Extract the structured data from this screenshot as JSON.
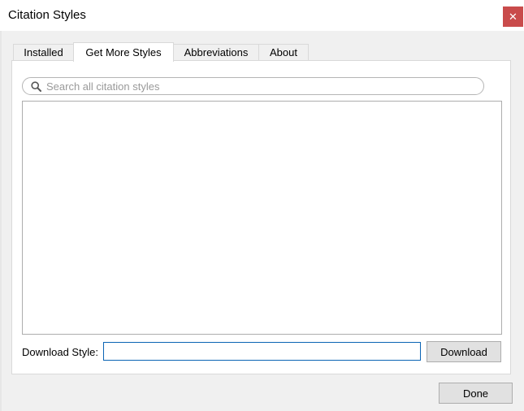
{
  "window": {
    "title": "Citation Styles",
    "close_symbol": "✕"
  },
  "tabs": [
    {
      "label": "Installed",
      "active": false
    },
    {
      "label": "Get More Styles",
      "active": true
    },
    {
      "label": "Abbreviations",
      "active": false
    },
    {
      "label": "About",
      "active": false
    }
  ],
  "search": {
    "placeholder": "Search all citation styles",
    "value": "",
    "icon": "search-icon"
  },
  "results": {
    "items": []
  },
  "download": {
    "label": "Download Style:",
    "value": "",
    "button_label": "Download"
  },
  "footer": {
    "done_label": "Done"
  },
  "colors": {
    "close_button": "#c94b4b",
    "focus_border": "#0a64b4",
    "button_face": "#e1e1e1",
    "window_bg": "#f0f0f0"
  }
}
